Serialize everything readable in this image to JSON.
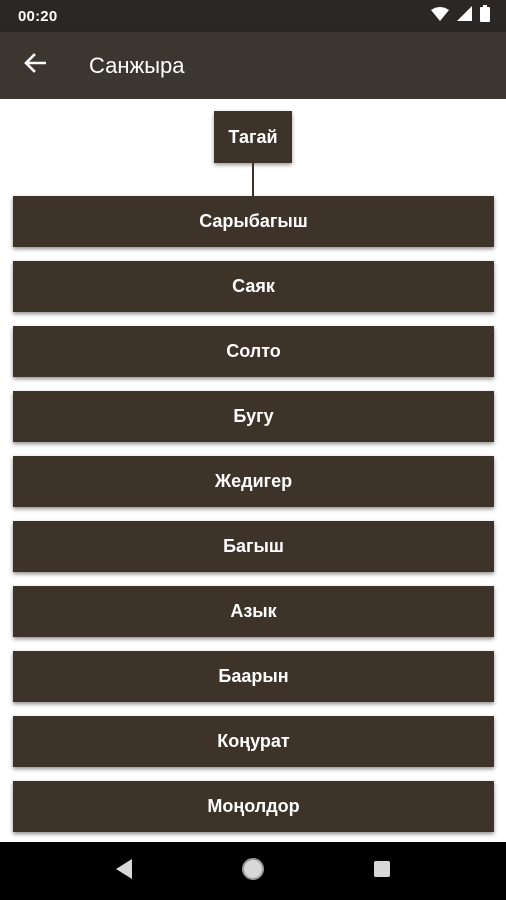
{
  "status_bar": {
    "time": "00:20",
    "icons": [
      "wifi-icon",
      "signal-icon",
      "battery-icon"
    ]
  },
  "app_bar": {
    "title": "Санжыра",
    "back_icon": "arrow-left-icon"
  },
  "tree": {
    "root": "Тагай",
    "branches": [
      {
        "label": "Сарыбагыш"
      },
      {
        "label": "Саяк"
      },
      {
        "label": "Солто"
      },
      {
        "label": "Бугу"
      },
      {
        "label": "Жедигер"
      },
      {
        "label": "Багыш"
      },
      {
        "label": "Азык"
      },
      {
        "label": "Баарын"
      },
      {
        "label": "Коңурат"
      },
      {
        "label": "Моңолдор"
      }
    ]
  },
  "nav_bar": {
    "icons": [
      "back-triangle-icon",
      "home-circle-icon",
      "recents-square-icon"
    ]
  },
  "colors": {
    "status_bar": "#2a2724",
    "app_bar": "#3b3630",
    "node_bg": "#3d3328",
    "node_text": "#ffffff",
    "nav_bar": "#000000"
  }
}
